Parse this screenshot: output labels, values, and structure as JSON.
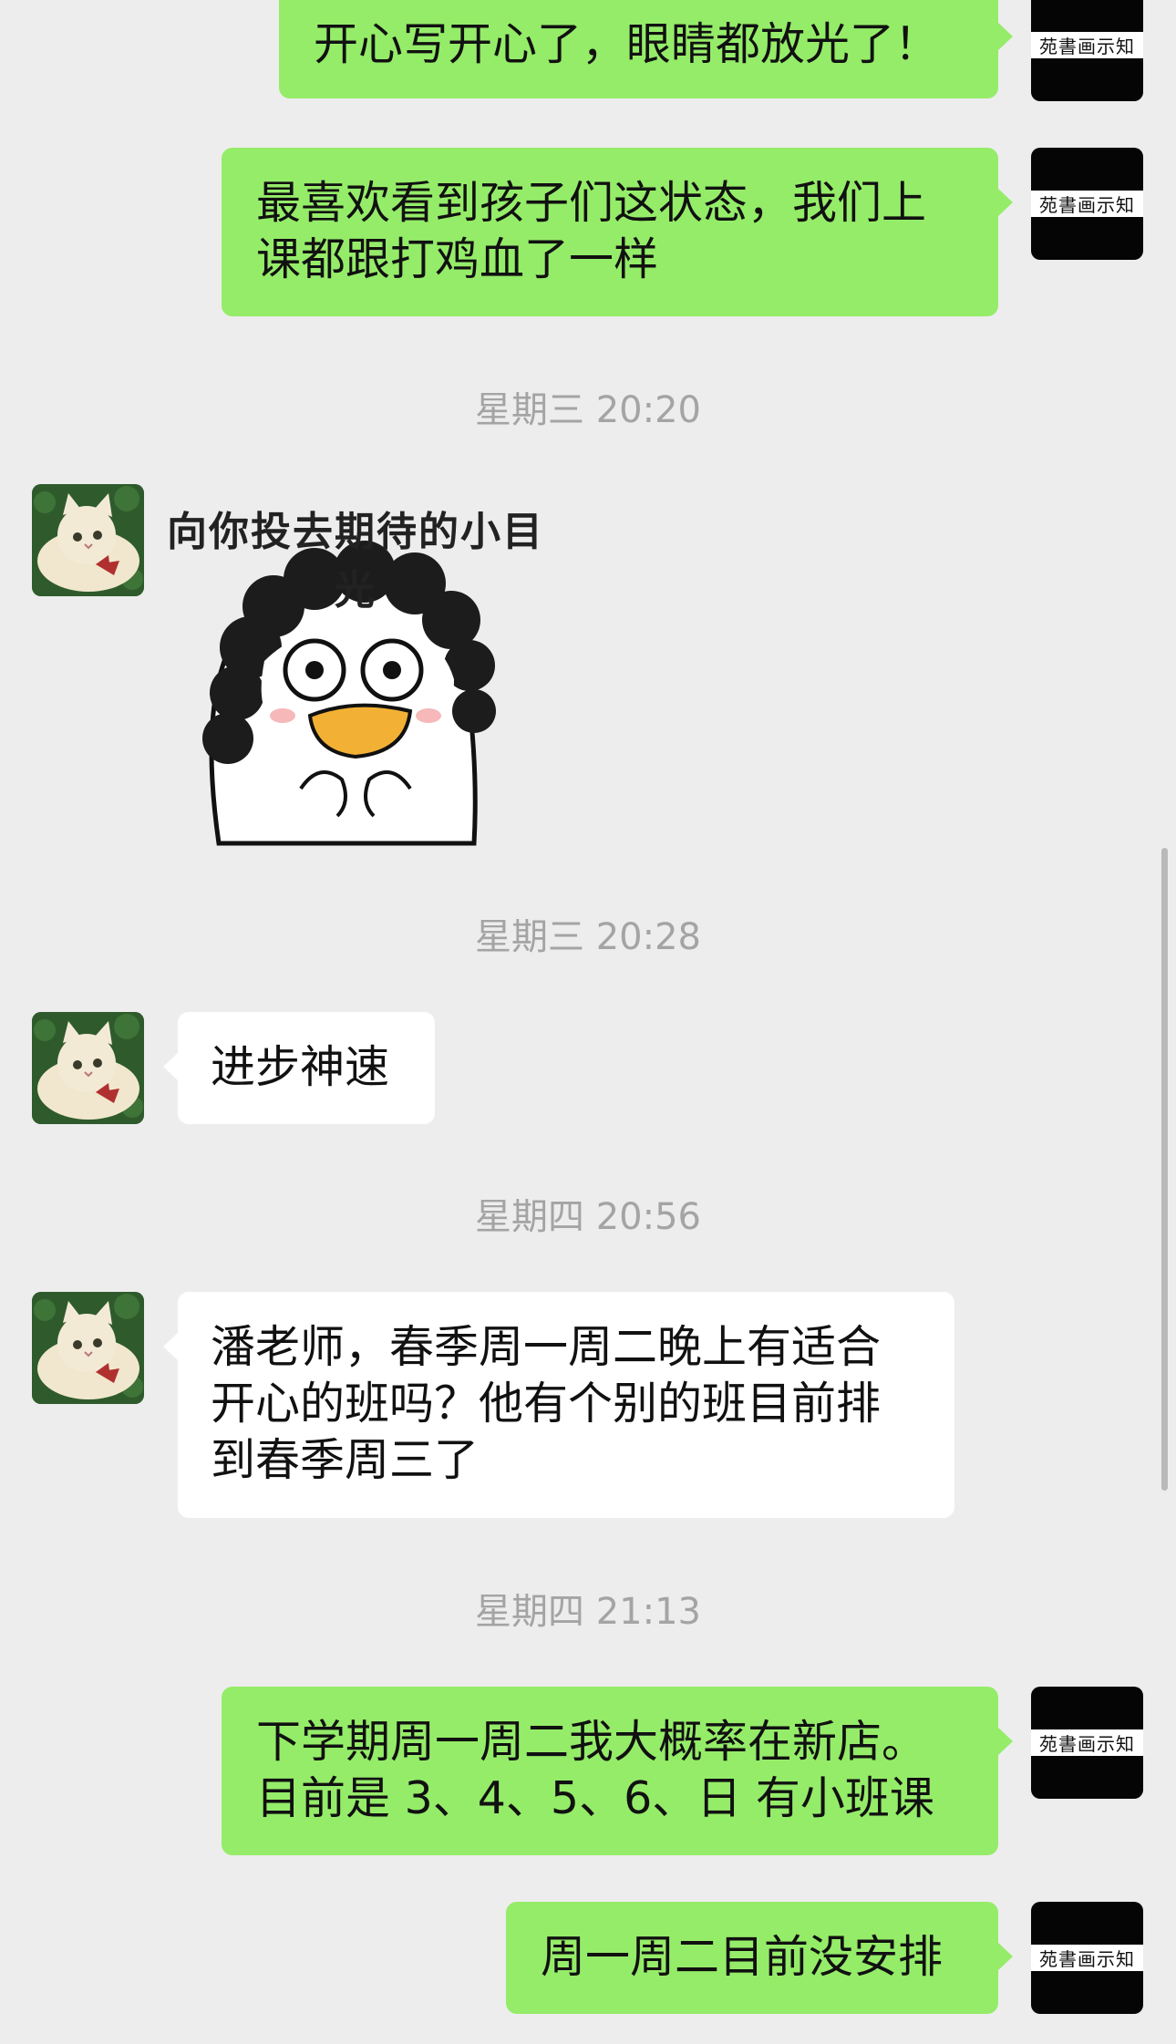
{
  "timestamps": {
    "t1": "星期三 20:20",
    "t2": "星期三 20:28",
    "t3": "星期四 20:56",
    "t4": "星期四 21:13"
  },
  "messages": {
    "m0": "开心写开心了，眼睛都放光了！",
    "m1": "最喜欢看到孩子们这状态，我们上课都跟打鸡血了一样",
    "m2": "进步神速",
    "m3": "潘老师，春季周一周二晚上有适合开心的班吗？他有个别的班目前排到春季周三了",
    "m4": "下学期周一周二我大概率在新店。目前是 3、4、5、6、日  有小班课",
    "m5": "周一周二目前没安排"
  },
  "sticker": {
    "caption": "向你投去期待的小目光"
  },
  "brand_avatar": {
    "text": "苑書画示知"
  },
  "colors": {
    "background": "#ededed",
    "sent_bubble": "#95ec69",
    "received_bubble": "#ffffff",
    "timestamp": "#a4a4a4"
  },
  "icons": {
    "contact_avatar": "cat-avatar-icon",
    "own_avatar": "brand-logo-icon"
  }
}
